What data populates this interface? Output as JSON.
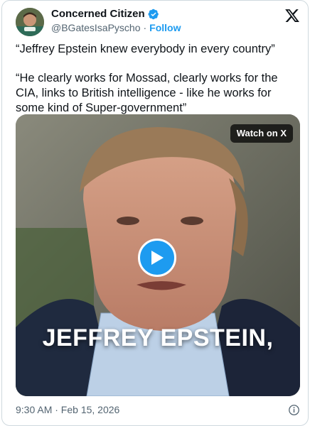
{
  "author": {
    "display_name": "Concerned Citizen",
    "handle": "@BGatesIsaPyscho",
    "separator": "·",
    "follow_label": "Follow",
    "verified_icon": "verified-badge-icon",
    "avatar_icon": "avatar-photo"
  },
  "brand": {
    "logo_icon": "x-logo-icon"
  },
  "tweet": {
    "paragraphs": [
      "“Jeffrey Epstein knew everybody in every country”",
      "“He clearly works for Mossad, clearly works for the CIA, links to British intelligence - like he works for some kind of Super-government”"
    ]
  },
  "media": {
    "watch_label": "Watch on X",
    "caption": "JEFFREY EPSTEIN,",
    "play_icon": "play-icon"
  },
  "footer": {
    "timestamp": "9:30 AM · Feb 15, 2026",
    "info_icon": "info-icon"
  },
  "colors": {
    "accent": "#1d9bf0",
    "text": "#0f1419",
    "muted": "#536471",
    "border": "#cfd9de"
  }
}
